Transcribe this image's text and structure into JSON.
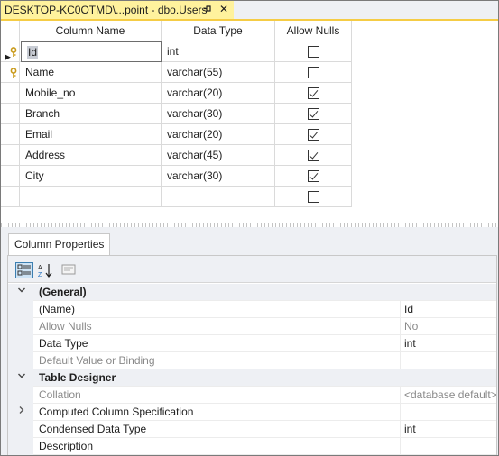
{
  "window": {
    "tab_title": "DESKTOP-KC0OTMD\\...point - dbo.Users",
    "pin_icon": "pin-icon",
    "close_label": "✕"
  },
  "grid": {
    "headers": {
      "name": "Column Name",
      "type": "Data Type",
      "nulls": "Allow Nulls"
    },
    "rows": [
      {
        "name": "Id",
        "type": "int",
        "allow_nulls": false,
        "primary_key": true,
        "current": true
      },
      {
        "name": "Name",
        "type": "varchar(55)",
        "allow_nulls": false,
        "primary_key": true,
        "current": false
      },
      {
        "name": "Mobile_no",
        "type": "varchar(20)",
        "allow_nulls": true,
        "primary_key": false,
        "current": false
      },
      {
        "name": "Branch",
        "type": "varchar(30)",
        "allow_nulls": true,
        "primary_key": false,
        "current": false
      },
      {
        "name": "Email",
        "type": "varchar(20)",
        "allow_nulls": true,
        "primary_key": false,
        "current": false
      },
      {
        "name": "Address",
        "type": "varchar(45)",
        "allow_nulls": true,
        "primary_key": false,
        "current": false
      },
      {
        "name": "City",
        "type": "varchar(30)",
        "allow_nulls": true,
        "primary_key": false,
        "current": false
      },
      {
        "name": "",
        "type": "",
        "allow_nulls": false,
        "primary_key": false,
        "current": false
      }
    ]
  },
  "properties": {
    "tab_label": "Column Properties",
    "toolbar_icons": [
      "categorized-icon",
      "alphabetical-sort-icon",
      "property-pages-icon"
    ],
    "rows": [
      {
        "kind": "category",
        "name": "(General)",
        "value": "",
        "expanded": true
      },
      {
        "kind": "prop",
        "name": "(Name)",
        "value": "Id",
        "dim": false
      },
      {
        "kind": "prop",
        "name": "Allow Nulls",
        "value": "No",
        "dim": true
      },
      {
        "kind": "prop",
        "name": "Data Type",
        "value": "int",
        "dim": false
      },
      {
        "kind": "prop",
        "name": "Default Value or Binding",
        "value": "",
        "dim": true
      },
      {
        "kind": "category",
        "name": "Table Designer",
        "value": "",
        "expanded": true
      },
      {
        "kind": "prop",
        "name": "Collation",
        "value": "<database default>",
        "dim": true
      },
      {
        "kind": "prop",
        "name": "Computed Column Specification",
        "value": "",
        "dim": false,
        "expandable": true
      },
      {
        "kind": "prop",
        "name": "Condensed Data Type",
        "value": "int",
        "dim": false
      },
      {
        "kind": "prop",
        "name": "Description",
        "value": "",
        "dim": false
      }
    ]
  }
}
